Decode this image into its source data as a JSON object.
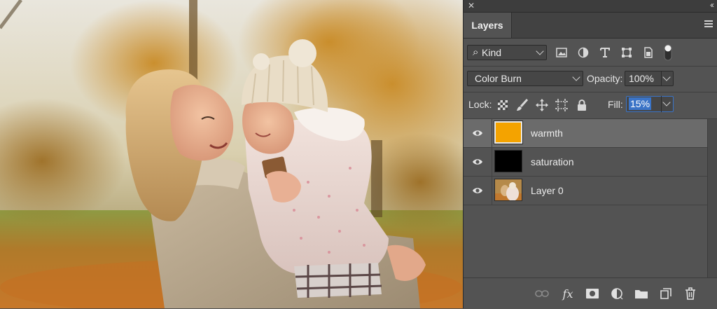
{
  "canvas": {
    "image_name": "mother-and-child-autumn-photo"
  },
  "panel": {
    "close_glyph": "✕",
    "collapse_glyph": "‹‹",
    "tab": "Layers",
    "filter": {
      "search_glyph": "⌕",
      "kind_label": "Kind",
      "filter_icons": [
        "pixel-layer-filter-icon",
        "adjustment-layer-filter-icon",
        "type-layer-filter-icon",
        "shape-layer-filter-icon",
        "smart-object-filter-icon",
        "filter-toggle-icon"
      ]
    },
    "blend": {
      "mode": "Color Burn",
      "opacity_label": "Opacity:",
      "opacity_value": "100%"
    },
    "lock": {
      "label": "Lock:",
      "fill_label": "Fill:",
      "fill_value": "15%"
    },
    "layers": [
      {
        "name": "warmth",
        "thumb_color": "#f4a300",
        "selected": true,
        "visible": true
      },
      {
        "name": "saturation",
        "thumb_color": "#000000",
        "selected": false,
        "visible": true
      },
      {
        "name": "Layer 0",
        "thumb_color": "photo",
        "selected": false,
        "visible": true
      }
    ],
    "bottom_icons": [
      "link-layers-icon",
      "fx-icon",
      "layer-mask-icon",
      "adjustment-layer-icon",
      "group-folder-icon",
      "new-layer-icon",
      "trash-icon"
    ],
    "fx_label": "fx"
  },
  "colors": {
    "panel_bg": "#535353",
    "selected_row": "#6b6b6b",
    "fill_highlight": "#3b74c7",
    "warmth_swatch": "#f4a300"
  }
}
